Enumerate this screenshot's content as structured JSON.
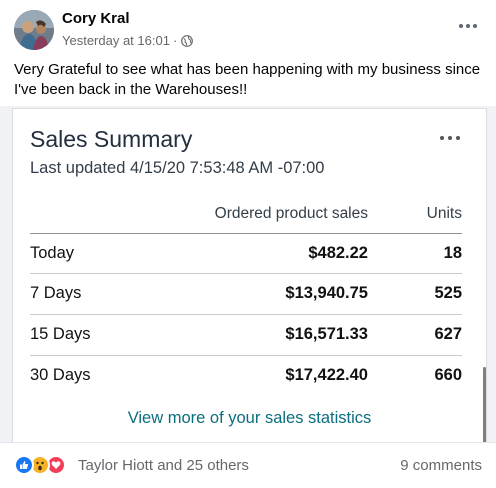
{
  "post": {
    "author": "Cory Kral",
    "timestamp": "Yesterday at 16:01",
    "separator": "·",
    "privacy_icon": "globe-icon",
    "more_icon": "ellipsis-icon",
    "text": "Very Grateful to see what has been happening with my business since I've been back in the Warehouses!!"
  },
  "card": {
    "title": "Sales Summary",
    "last_updated": "Last updated 4/15/20 7:53:48 AM -07:00",
    "more_icon": "ellipsis-icon",
    "columns": {
      "sales": "Ordered product sales",
      "units": "Units"
    },
    "rows": [
      {
        "label": "Today",
        "sales": "$482.22",
        "units": "18"
      },
      {
        "label": "7 Days",
        "sales": "$13,940.75",
        "units": "525"
      },
      {
        "label": "15 Days",
        "sales": "$16,571.33",
        "units": "627"
      },
      {
        "label": "30 Days",
        "sales": "$17,422.40",
        "units": "660"
      }
    ],
    "view_more": "View more of your sales statistics",
    "accent_color": "#0b6e7e"
  },
  "footer": {
    "reactions": [
      "like-icon",
      "wow-icon",
      "love-icon"
    ],
    "reaction_names": "Taylor Hiott and 25 others",
    "comments": "9 comments"
  }
}
